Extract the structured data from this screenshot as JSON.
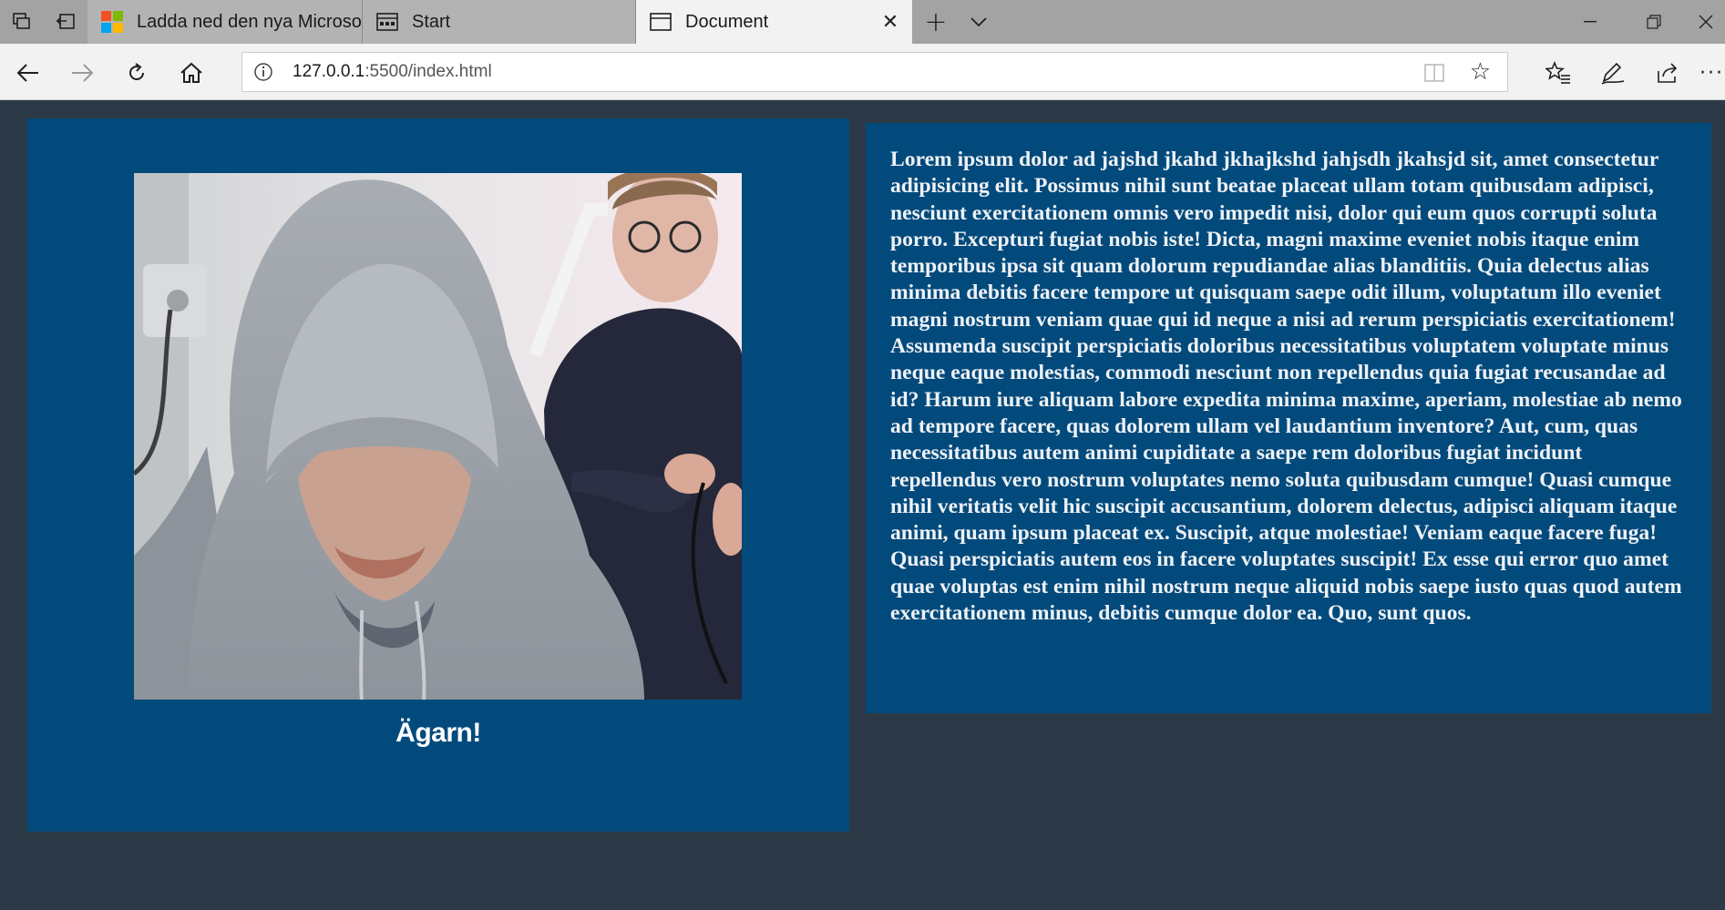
{
  "browser": {
    "tabs": [
      {
        "title": "Ladda ned den nya Microso",
        "icon": "microsoft-logo-icon"
      },
      {
        "title": "Start",
        "icon": "start-page-icon"
      },
      {
        "title": "Document",
        "icon": "document-page-icon",
        "active": true
      }
    ],
    "address": {
      "host": "127.0.0.1",
      "rest": ":5500/index.html"
    },
    "colors": {
      "tabbar": "#a3a3a3",
      "active_tab": "#f2f2f2"
    }
  },
  "page": {
    "caption": "Ägarn!",
    "paragraph": "Lorem ipsum dolor ad jajshd jkahd jkhajkshd jahjsdh jkahsjd sit, amet consectetur adipisicing elit. Possimus nihil sunt beatae placeat ullam totam quibusdam adipisci, nesciunt exercitationem omnis vero impedit nisi, dolor qui eum quos corrupti soluta porro. Excepturi fugiat nobis iste! Dicta, magni maxime eveniet nobis itaque enim temporibus ipsa sit quam dolorum repudiandae alias blanditiis. Quia delectus alias minima debitis facere tempore ut quisquam saepe odit illum, voluptatum illo eveniet magni nostrum veniam quae qui id neque a nisi ad rerum perspiciatis exercitationem! Assumenda suscipit perspiciatis doloribus necessitatibus voluptatem voluptate minus neque eaque molestias, commodi nesciunt non repellendus quia fugiat recusandae ad id? Harum iure aliquam labore expedita minima maxime, aperiam, molestiae ab nemo ad tempore facere, quas dolorem ullam vel laudantium inventore? Aut, cum, quas necessitatibus autem animi cupiditate a saepe rem doloribus fugiat incidunt repellendus vero nostrum voluptates nemo soluta quibusdam cumque! Quasi cumque nihil veritatis velit hic suscipit accusantium, dolorem delectus, adipisci aliquam itaque animi, quam ipsum placeat ex. Suscipit, atque molestiae! Veniam eaque facere fuga! Quasi perspiciatis autem eos in facere voluptates suscipit! Ex esse qui error quo amet quae voluptas est enim nihil nostrum neque aliquid nobis saepe iusto quas quod autem exercitationem minus, debitis cumque dolor ea. Quo, sunt quos.",
    "colors": {
      "background": "#2b3a46",
      "card": "#034a7c",
      "text": "#eef2f6"
    }
  }
}
